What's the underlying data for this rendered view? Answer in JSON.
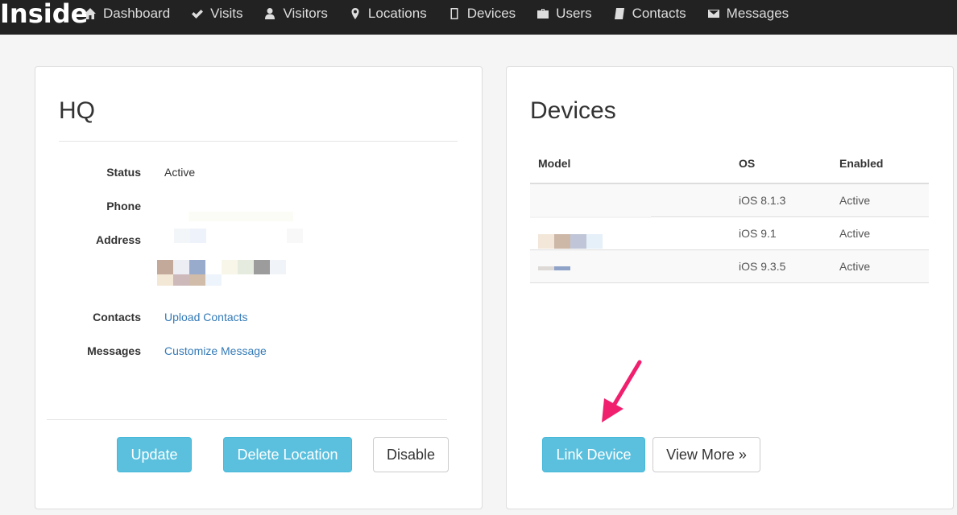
{
  "app": {
    "brand": "Inside"
  },
  "nav": {
    "items": [
      {
        "label": "Dashboard",
        "icon": "home-icon"
      },
      {
        "label": "Visits",
        "icon": "check-icon"
      },
      {
        "label": "Visitors",
        "icon": "user-icon"
      },
      {
        "label": "Locations",
        "icon": "map-marker-icon"
      },
      {
        "label": "Devices",
        "icon": "tablet-icon"
      },
      {
        "label": "Users",
        "icon": "briefcase-icon"
      },
      {
        "label": "Contacts",
        "icon": "book-icon"
      },
      {
        "label": "Messages",
        "icon": "envelope-icon"
      }
    ]
  },
  "location": {
    "title": "HQ",
    "fields": {
      "status_label": "Status",
      "status_value": "Active",
      "phone_label": "Phone",
      "address_label": "Address",
      "contacts_label": "Contacts",
      "contacts_link": "Upload Contacts",
      "messages_label": "Messages",
      "messages_link": "Customize Message"
    },
    "buttons": {
      "update": "Update",
      "delete": "Delete Location",
      "disable": "Disable"
    }
  },
  "devices": {
    "title": "Devices",
    "columns": [
      "Model",
      "OS",
      "Enabled"
    ],
    "rows": [
      {
        "model": "",
        "os": "iOS 8.1.3",
        "enabled": "Active"
      },
      {
        "model": "",
        "os": "iOS 9.1",
        "enabled": "Active"
      },
      {
        "model": "",
        "os": "iOS 9.3.5",
        "enabled": "Active"
      }
    ],
    "buttons": {
      "link_device": "Link Device",
      "view_more": "View More »"
    }
  },
  "colors": {
    "navbar": "#222222",
    "info_button": "#5bc0de",
    "link": "#337ab7",
    "annotation_arrow": "#f0206e"
  }
}
